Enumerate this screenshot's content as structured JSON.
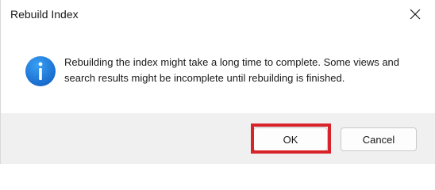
{
  "dialog": {
    "title": "Rebuild Index",
    "close_icon": "close-icon",
    "message": "Rebuilding the index might take a long time to complete. Some views and search results might be incomplete until rebuilding is finished.",
    "info_icon": "info-icon",
    "buttons": {
      "ok_label": "OK",
      "cancel_label": "Cancel"
    }
  },
  "colors": {
    "info_icon_blue": "#1a73d9",
    "highlight_red": "#d8232a",
    "footer_bg": "#f0f0f0"
  }
}
